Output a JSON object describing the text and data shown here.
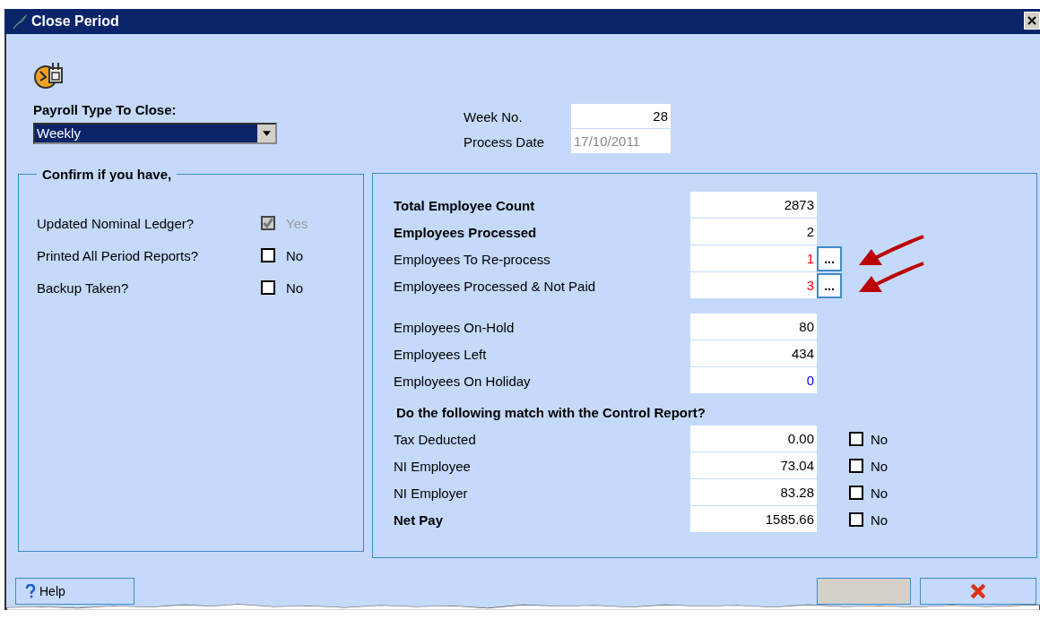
{
  "window": {
    "title": "Close Period"
  },
  "payroll_type": {
    "label": "Payroll Type To Close:",
    "value": "Weekly"
  },
  "week_no": {
    "label": "Week No.",
    "value": "28"
  },
  "process_date": {
    "label": "Process Date",
    "value": "17/10/2011",
    "disabled": true
  },
  "confirm": {
    "title": "Confirm if you have,",
    "items": [
      {
        "label": "Updated Nominal Ledger?",
        "checked": true,
        "disabled": true,
        "answer": "Yes"
      },
      {
        "label": "Printed All Period Reports?",
        "checked": false,
        "disabled": false,
        "answer": "No"
      },
      {
        "label": "Backup Taken?",
        "checked": false,
        "disabled": false,
        "answer": "No"
      }
    ]
  },
  "processing": [
    {
      "label": "Total Employee Count",
      "value": "2873",
      "bold": true,
      "color": "#000000",
      "kind": "plain"
    },
    {
      "label": "Employees Processed",
      "value": "2",
      "bold": true,
      "color": "#000000",
      "kind": "plain"
    },
    {
      "label": "Employees To Re-process",
      "value": "1",
      "bold": false,
      "color": "#ff0000",
      "kind": "details",
      "details": "...",
      "flagged": true
    },
    {
      "label": "Employees Processed & Not Paid",
      "value": "3",
      "bold": false,
      "color": "#ff0000",
      "kind": "details",
      "details": "...",
      "flagged": true
    }
  ],
  "status": [
    {
      "label": "Employees On-Hold",
      "value": "80",
      "bold": false,
      "color": "#000000"
    },
    {
      "label": "Employees Left",
      "value": "434",
      "bold": false,
      "color": "#000000"
    },
    {
      "label": "Employees On Holiday",
      "value": "0",
      "bold": false,
      "color": "#0000ff"
    }
  ],
  "match": {
    "title": "Do the following match with the Control Report?",
    "rows": [
      {
        "label": "Tax Deducted",
        "value": "0.00",
        "bold": false,
        "checked": false,
        "answer": "No"
      },
      {
        "label": "NI Employee",
        "value": "73.04",
        "bold": false,
        "checked": false,
        "answer": "No"
      },
      {
        "label": "NI Employer",
        "value": "83.28",
        "bold": false,
        "checked": false,
        "answer": "No"
      },
      {
        "label": "Net Pay",
        "value": "1585.66",
        "bold": true,
        "checked": false,
        "answer": "No"
      }
    ]
  },
  "buttons": [
    {
      "kind": "help",
      "label": "Help",
      "disabled": false
    },
    {
      "kind": "blank",
      "disabled": true
    },
    {
      "kind": "close",
      "disabled": false
    }
  ]
}
